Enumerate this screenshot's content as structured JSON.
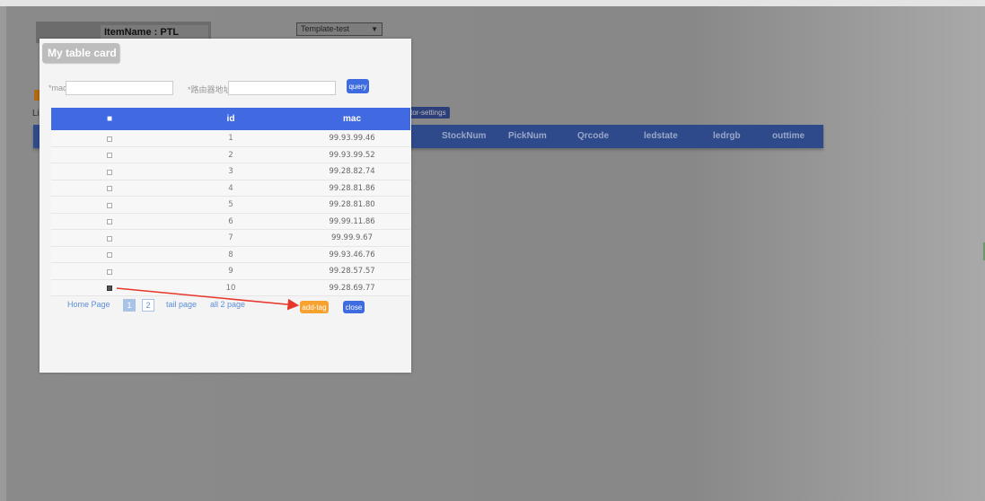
{
  "background": {
    "item_name": "ItemName : PTL",
    "template_select": "Template-test",
    "li_label": "Li",
    "settings_button": "tor-settings",
    "columns": [
      "StockNum",
      "PickNum",
      "Qrcode",
      "ledstate",
      "ledrgb",
      "outtime"
    ]
  },
  "modal": {
    "title": "My table card",
    "search": {
      "mac_label": "*mac",
      "mac_value": "",
      "router_label": "*路由器地址",
      "router_value": "",
      "query_button": "query"
    },
    "table": {
      "headers": {
        "check": "■",
        "id": "id",
        "mac": "mac"
      },
      "rows": [
        {
          "id": "1",
          "mac": "99.93.99.46",
          "checked": false
        },
        {
          "id": "2",
          "mac": "99.93.99.52",
          "checked": false
        },
        {
          "id": "3",
          "mac": "99.28.82.74",
          "checked": false
        },
        {
          "id": "4",
          "mac": "99.28.81.86",
          "checked": false
        },
        {
          "id": "5",
          "mac": "99.28.81.80",
          "checked": false
        },
        {
          "id": "6",
          "mac": "99.99.11.86",
          "checked": false
        },
        {
          "id": "7",
          "mac": "99.99.9.67",
          "checked": false
        },
        {
          "id": "8",
          "mac": "99.93.46.76",
          "checked": false
        },
        {
          "id": "9",
          "mac": "99.28.57.57",
          "checked": false
        },
        {
          "id": "10",
          "mac": "99.28.69.77",
          "checked": true
        }
      ]
    },
    "pager": {
      "home": "Home Page",
      "page1": "1",
      "page2": "2",
      "tail": "tail page",
      "total": "all 2 page",
      "current_page": 1
    },
    "add_tag_button": "add-tag",
    "close_button": "close"
  },
  "colors": {
    "header_blue": "#4169e1",
    "add_tag_orange": "#f7a12f",
    "annotation_arrow": "#e8362b"
  }
}
